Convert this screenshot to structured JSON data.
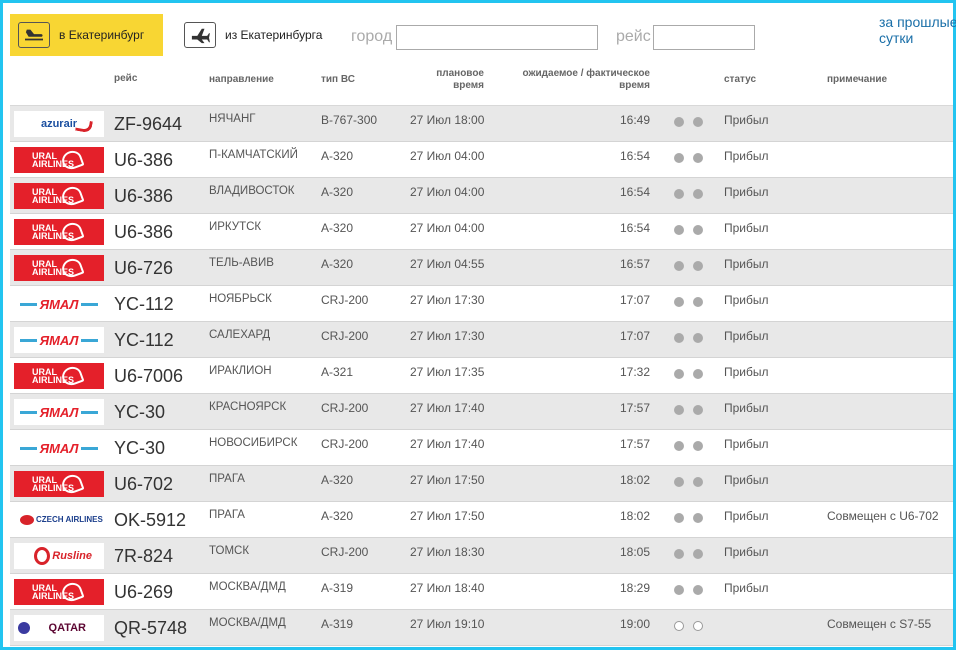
{
  "tabs": {
    "arrivals": "в Екатеринбург",
    "departures": "из Екатеринбурга"
  },
  "search": {
    "city_label": "город",
    "city_value": "",
    "flight_label": "рейс",
    "flight_value": ""
  },
  "past_link": [
    "за прошлые",
    "сутки"
  ],
  "columns": {
    "flight": "рейс",
    "destination": "направление",
    "aircraft": "тип ВС",
    "scheduled": [
      "плановое",
      "время"
    ],
    "actual": [
      "ожидаемое / фактическое",
      "время"
    ],
    "status": "статус",
    "note": "примечание"
  },
  "rows": [
    {
      "airline": "azur",
      "logo_text": "azurair",
      "flight": "ZF-9644",
      "destination": "НЯЧАНГ",
      "aircraft": "B-767-300",
      "scheduled": "27 Июл 18:00",
      "actual": "16:49",
      "dots": "filled",
      "status": "Прибыл",
      "note": ""
    },
    {
      "airline": "ural",
      "logo_text": "URAL AIRLINES",
      "flight": "U6-386",
      "destination": "П-КАМЧАТСКИЙ",
      "aircraft": "A-320",
      "scheduled": "27 Июл 04:00",
      "actual": "16:54",
      "dots": "filled",
      "status": "Прибыл",
      "note": ""
    },
    {
      "airline": "ural",
      "logo_text": "URAL AIRLINES",
      "flight": "U6-386",
      "destination": "ВЛАДИВОСТОК",
      "aircraft": "A-320",
      "scheduled": "27 Июл 04:00",
      "actual": "16:54",
      "dots": "filled",
      "status": "Прибыл",
      "note": ""
    },
    {
      "airline": "ural",
      "logo_text": "URAL AIRLINES",
      "flight": "U6-386",
      "destination": "ИРКУТСК",
      "aircraft": "A-320",
      "scheduled": "27 Июл 04:00",
      "actual": "16:54",
      "dots": "filled",
      "status": "Прибыл",
      "note": ""
    },
    {
      "airline": "ural",
      "logo_text": "URAL AIRLINES",
      "flight": "U6-726",
      "destination": "ТЕЛЬ-АВИВ",
      "aircraft": "A-320",
      "scheduled": "27 Июл 04:55",
      "actual": "16:57",
      "dots": "filled",
      "status": "Прибыл",
      "note": ""
    },
    {
      "airline": "yamal",
      "logo_text": "ЯМАЛ",
      "flight": "YC-112",
      "destination": "НОЯБРЬСК",
      "aircraft": "CRJ-200",
      "scheduled": "27 Июл 17:30",
      "actual": "17:07",
      "dots": "filled",
      "status": "Прибыл",
      "note": ""
    },
    {
      "airline": "yamal",
      "logo_text": "ЯМАЛ",
      "flight": "YC-112",
      "destination": "САЛЕХАРД",
      "aircraft": "CRJ-200",
      "scheduled": "27 Июл 17:30",
      "actual": "17:07",
      "dots": "filled",
      "status": "Прибыл",
      "note": ""
    },
    {
      "airline": "ural",
      "logo_text": "URAL AIRLINES",
      "flight": "U6-7006",
      "destination": "ИРАКЛИОН",
      "aircraft": "A-321",
      "scheduled": "27 Июл 17:35",
      "actual": "17:32",
      "dots": "filled",
      "status": "Прибыл",
      "note": ""
    },
    {
      "airline": "yamal",
      "logo_text": "ЯМАЛ",
      "flight": "YC-30",
      "destination": "КРАСНОЯРСК",
      "aircraft": "CRJ-200",
      "scheduled": "27 Июл 17:40",
      "actual": "17:57",
      "dots": "filled",
      "status": "Прибыл",
      "note": ""
    },
    {
      "airline": "yamal",
      "logo_text": "ЯМАЛ",
      "flight": "YC-30",
      "destination": "НОВОСИБИРСК",
      "aircraft": "CRJ-200",
      "scheduled": "27 Июл 17:40",
      "actual": "17:57",
      "dots": "filled",
      "status": "Прибыл",
      "note": ""
    },
    {
      "airline": "ural",
      "logo_text": "URAL AIRLINES",
      "flight": "U6-702",
      "destination": "ПРАГА",
      "aircraft": "A-320",
      "scheduled": "27 Июл 17:50",
      "actual": "18:02",
      "dots": "filled",
      "status": "Прибыл",
      "note": ""
    },
    {
      "airline": "czech",
      "logo_text": "CZECH AIRLINES",
      "flight": "OK-5912",
      "destination": "ПРАГА",
      "aircraft": "A-320",
      "scheduled": "27 Июл 17:50",
      "actual": "18:02",
      "dots": "filled",
      "status": "Прибыл",
      "note": "Совмещен с U6-702"
    },
    {
      "airline": "rustline",
      "logo_text": "Rusline",
      "flight": "7R-824",
      "destination": "ТОМСК",
      "aircraft": "CRJ-200",
      "scheduled": "27 Июл 18:30",
      "actual": "18:05",
      "dots": "filled",
      "status": "Прибыл",
      "note": ""
    },
    {
      "airline": "ural",
      "logo_text": "URAL AIRLINES",
      "flight": "U6-269",
      "destination": "МОСКВА/ДМД",
      "aircraft": "A-319",
      "scheduled": "27 Июл 18:40",
      "actual": "18:29",
      "dots": "filled",
      "status": "Прибыл",
      "note": ""
    },
    {
      "airline": "qatar",
      "logo_text": "QATAR",
      "flight": "QR-5748",
      "destination": "МОСКВА/ДМД",
      "aircraft": "A-319",
      "scheduled": "27 Июл 19:10",
      "actual": "19:00",
      "dots": "hollow",
      "status": "",
      "note": "Совмещен с S7-55"
    }
  ],
  "colors": {
    "frame_border": "#22c4f0",
    "active_tab": "#f8d633",
    "row_alt": "#e8e8e8",
    "link": "#1a6fa8",
    "ural_red": "#e4202a"
  },
  "icons": {
    "arrivals_tab": "plane-landing-icon",
    "departures_tab": "plane-takeoff-icon",
    "status_dots": "status-dot-icon"
  }
}
